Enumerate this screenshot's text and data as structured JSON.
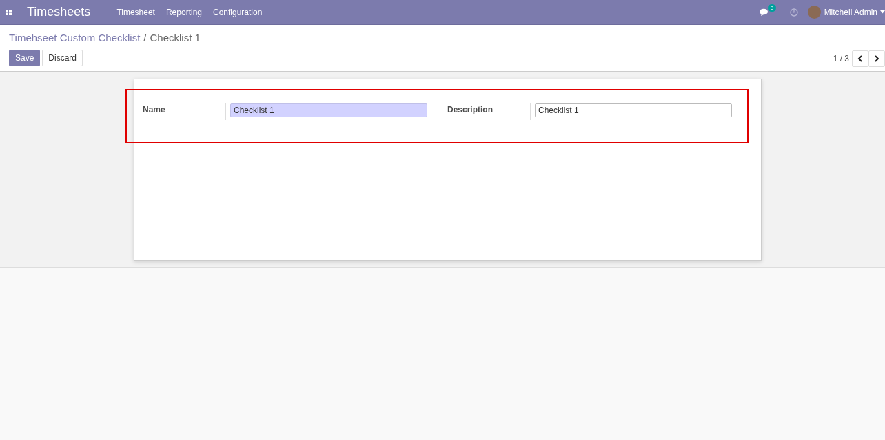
{
  "navbar": {
    "app_name": "Timesheets",
    "menu": [
      "Timesheet",
      "Reporting",
      "Configuration"
    ],
    "message_count": "3",
    "user": "Mitchell Admin"
  },
  "breadcrumb": [
    "Timehseet Custom Checklist",
    "/",
    "Checklist 1"
  ],
  "buttons": [
    {
      "label": "Save",
      "kind": "primary"
    },
    {
      "label": "Discard",
      "kind": "secondary"
    }
  ],
  "pager": "1 / 3",
  "fields": [
    {
      "label": "Name",
      "value": "Checklist 1",
      "required": true
    },
    {
      "label": "Description",
      "value": "Checklist 1",
      "required": false
    }
  ]
}
